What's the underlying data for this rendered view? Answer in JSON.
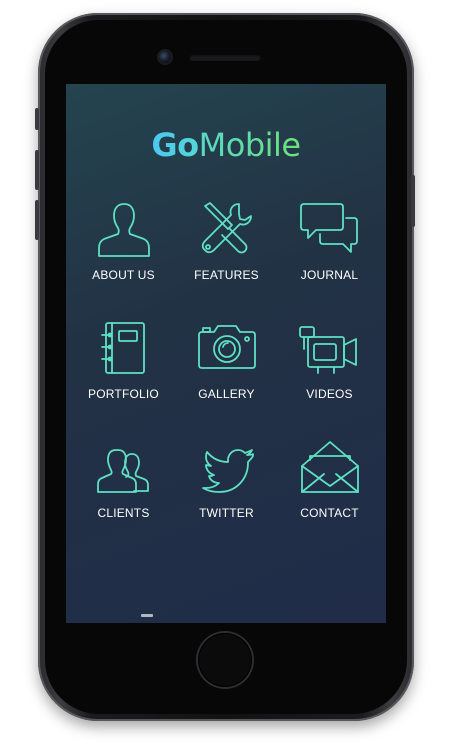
{
  "app": {
    "logo_part1": "Go",
    "logo_part2": "Mobile",
    "accent_colors": [
      "#4cc7f0",
      "#6fe07a"
    ],
    "icon_stroke_color": "#5ee0c2"
  },
  "menu": {
    "items": [
      {
        "label": "ABOUT US",
        "icon": "person-icon"
      },
      {
        "label": "FEATURES",
        "icon": "tools-icon"
      },
      {
        "label": "JOURNAL",
        "icon": "chat-bubbles-icon"
      },
      {
        "label": "PORTFOLIO",
        "icon": "notebook-icon"
      },
      {
        "label": "GALLERY",
        "icon": "camera-icon"
      },
      {
        "label": "VIDEOS",
        "icon": "video-camera-icon"
      },
      {
        "label": "CLIENTS",
        "icon": "people-icon"
      },
      {
        "label": "TWITTER",
        "icon": "bird-icon"
      },
      {
        "label": "CONTACT",
        "icon": "envelope-icon"
      }
    ]
  }
}
